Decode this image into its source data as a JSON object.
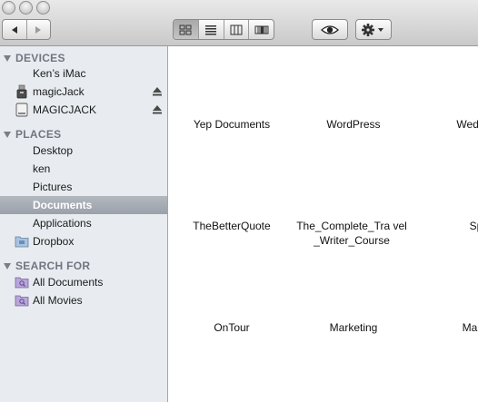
{
  "toolbar": {
    "back_icon": "back-arrow-icon",
    "forward_icon": "forward-arrow-icon",
    "views": [
      "icon-view",
      "list-view",
      "column-view",
      "cover-flow-view"
    ],
    "active_view": "icon-view",
    "quicklook_icon": "eye-icon",
    "action_icon": "gear-icon"
  },
  "sidebar": {
    "devices": {
      "header": "DEVICES",
      "items": [
        {
          "label": "Ken’s iMac"
        },
        {
          "label": "magicJack"
        },
        {
          "label": "MAGICJACK"
        }
      ]
    },
    "places": {
      "header": "PLACES",
      "items": [
        {
          "label": "Desktop"
        },
        {
          "label": "ken"
        },
        {
          "label": "Pictures"
        },
        {
          "label": "Documents"
        },
        {
          "label": "Applications"
        },
        {
          "label": "Dropbox"
        }
      ]
    },
    "search": {
      "header": "SEARCH FOR",
      "items": [
        {
          "label": "All Documents"
        },
        {
          "label": "All Movies"
        }
      ]
    }
  },
  "files": [
    {
      "name": "Yep Documents"
    },
    {
      "name": "WordPress"
    },
    {
      "name": "Wedding"
    },
    {
      "name": "TheBetterQuote"
    },
    {
      "name": "The_Complete_Tra vel_Writer_Course"
    },
    {
      "name": "Speed"
    },
    {
      "name": "OnTour"
    },
    {
      "name": "Marketing"
    },
    {
      "name": "Ma"
    }
  ],
  "colors": {
    "sidebar_bg": "#e8ecf0",
    "selection": "#a3a9b1",
    "section_text": "#6f7680"
  }
}
